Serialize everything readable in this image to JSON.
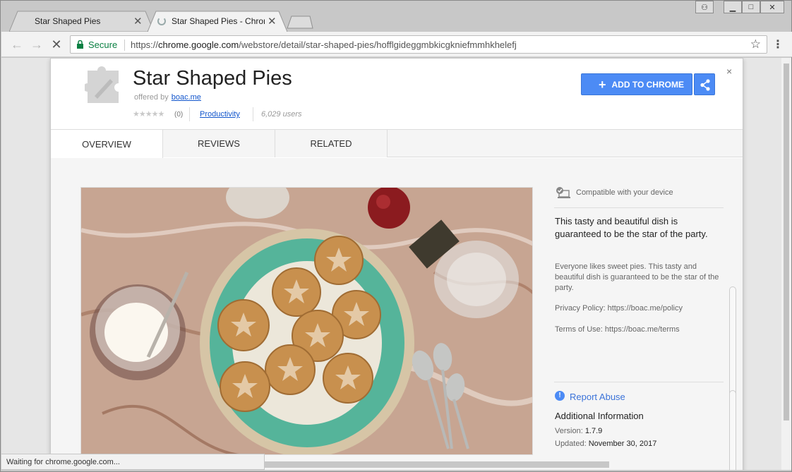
{
  "browser": {
    "tabs": [
      {
        "title": "Star Shaped Pies",
        "close": "✕"
      },
      {
        "title": "Star Shaped Pies - Chrome",
        "close": "✕"
      }
    ],
    "window_controls": {
      "profile": "⚇",
      "minimize": "▁",
      "maximize": "□",
      "close": "✕"
    },
    "security_label": "Secure",
    "url_scheme": "https://",
    "url_host": "chrome.google.com",
    "url_path": "/webstore/detail/star-shaped-pies/hofflgideggmbkicgkniefmmhkhelefj",
    "status_text": "Waiting for chrome.google.com...",
    "accent": "#4c8bf5",
    "secure_color": "#0b8043"
  },
  "extension": {
    "name": "Star Shaped Pies",
    "offered_by_label": "offered by",
    "offered_by": "boac.me",
    "stars": "★★★★★",
    "rating_count": "(0)",
    "category": "Productivity",
    "users": "6,029 users",
    "add_button": "ADD TO CHROME",
    "close": "×"
  },
  "page_tabs": [
    "OVERVIEW",
    "REVIEWS",
    "RELATED"
  ],
  "details": {
    "compatibility": "Compatible with your device",
    "summary": "This tasty and beautiful dish is guaranteed to be the star of the party.",
    "description": "Everyone likes sweet pies. This tasty and beautiful dish is guaranteed to be the star of the party.",
    "privacy": "Privacy Policy: https://boac.me/policy",
    "terms": "Terms of Use: https://boac.me/terms",
    "report_abuse": "Report Abuse",
    "additional_heading": "Additional Information",
    "version_label": "Version:",
    "version": "1.7.9",
    "updated_label": "Updated:",
    "updated": "November 30, 2017"
  },
  "icons": {
    "back": "back-arrow-icon",
    "forward": "forward-arrow-icon",
    "stop": "stop-icon",
    "lock": "lock-icon",
    "bookmark": "star-icon",
    "menu": "kebab-menu-icon",
    "extension": "puzzle-piece-icon",
    "share": "share-icon",
    "compatible": "device-check-icon",
    "report": "info-icon"
  }
}
